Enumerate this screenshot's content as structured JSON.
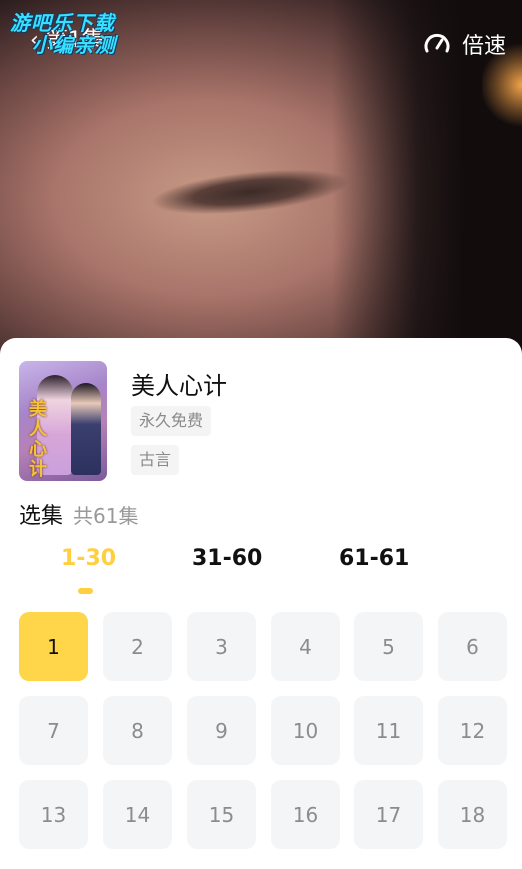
{
  "video": {
    "back_title": "第1集",
    "watermark_line1": "游吧乐下载",
    "watermark_line2": "小编亲测",
    "speed_label": "倍速"
  },
  "drama": {
    "title": "美人心计",
    "poster_text": "美人心计",
    "tags": [
      "永久免费",
      "古言"
    ]
  },
  "episodes_header": {
    "label": "选集",
    "count": "共61集"
  },
  "range_tabs": [
    "1-30",
    "31-60",
    "61-61"
  ],
  "episodes": [
    "1",
    "2",
    "3",
    "4",
    "5",
    "6",
    "7",
    "8",
    "9",
    "10",
    "11",
    "12",
    "13",
    "14",
    "15",
    "16",
    "17",
    "18"
  ],
  "colors": {
    "accent": "#ffcf3f",
    "active_episode_bg": "#ffd54a",
    "episode_bg": "#f4f5f7"
  }
}
